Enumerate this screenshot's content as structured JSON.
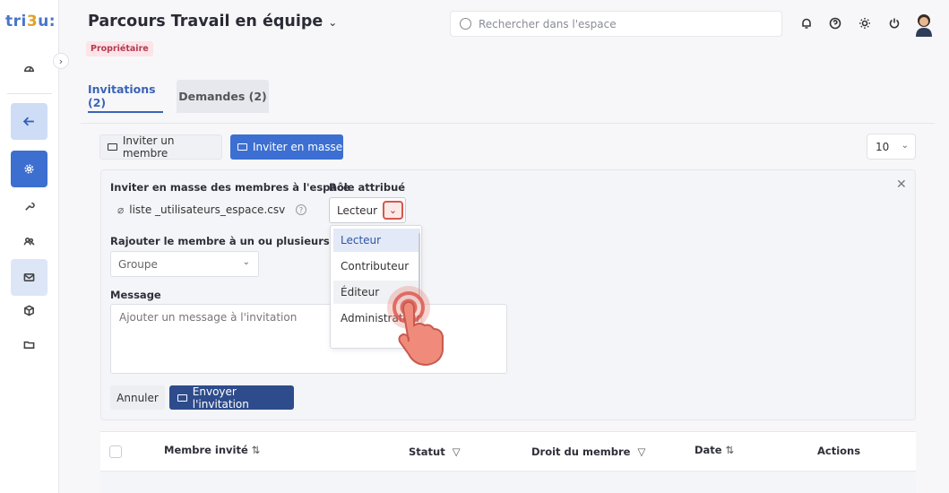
{
  "app": {
    "logo_text_a": "tri",
    "logo_text_b": "3",
    "logo_text_c": "u:",
    "space_title": "Parcours Travail en équipe",
    "role_badge": "Propriétaire",
    "search_placeholder": "Rechercher dans l'espace"
  },
  "header_icons": [
    "bell-icon",
    "help-icon",
    "sun-icon",
    "power-icon"
  ],
  "sidebar": {
    "icons": [
      "dashboard-icon",
      "back-arrow-icon",
      "settings-icon",
      "tools-icon",
      "members-icon",
      "mail-icon",
      "cube-icon",
      "folder-icon"
    ]
  },
  "tabs": [
    {
      "label": "Invitations (2)",
      "active": true
    },
    {
      "label": "Demandes (2)",
      "active": false
    }
  ],
  "toolbar": {
    "invite_member": "Inviter un membre",
    "invite_bulk": "Inviter en masse",
    "page_size": "10"
  },
  "bulk_form": {
    "bulk_label": "Inviter en masse des membres à l'espace",
    "file_name": "liste _utilisateurs_espace.csv",
    "role_label": "Rôle attribué",
    "role_value": "Lecteur",
    "group_label": "Rajouter le membre à un ou plusieurs group",
    "group_placeholder": "Groupe",
    "message_label": "Message",
    "message_placeholder": "Ajouter un message à l'invitation",
    "cancel": "Annuler",
    "send": "Envoyer l'invitation"
  },
  "role_menu": {
    "options": [
      "Lecteur",
      "Contributeur",
      "Éditeur",
      "Administrateur"
    ],
    "selected": "Lecteur"
  },
  "table": {
    "columns": [
      "Membre invité",
      "Statut",
      "Droit du membre",
      "Date",
      "Actions"
    ]
  },
  "colors": {
    "primary": "#3c6fd1",
    "dark_primary": "#2e4c8c",
    "badge_bg": "#fde4e8",
    "badge_text": "#b43a4e",
    "highlight": "#d6574d"
  }
}
